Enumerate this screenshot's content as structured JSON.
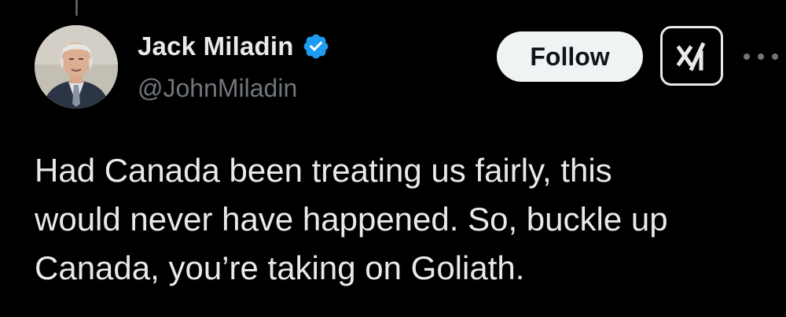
{
  "author": {
    "display_name": "Jack Miladin",
    "handle": "@JohnMiladin",
    "verified": true,
    "avatar_icon": "profile-photo"
  },
  "actions": {
    "follow_label": "Follow",
    "grok_icon": "grok-icon",
    "more_icon": "more-horizontal-icon"
  },
  "tweet": {
    "text": "Had Canada been treating us fairly, this\nwould never have happened. So, buckle up\nCanada, you’re taking on Goliath."
  },
  "colors": {
    "background": "#000000",
    "primary_text": "#e7e9ea",
    "secondary_text": "#71767b",
    "verified_badge": "#1d9bf0",
    "follow_button_bg": "#eff3f4"
  }
}
